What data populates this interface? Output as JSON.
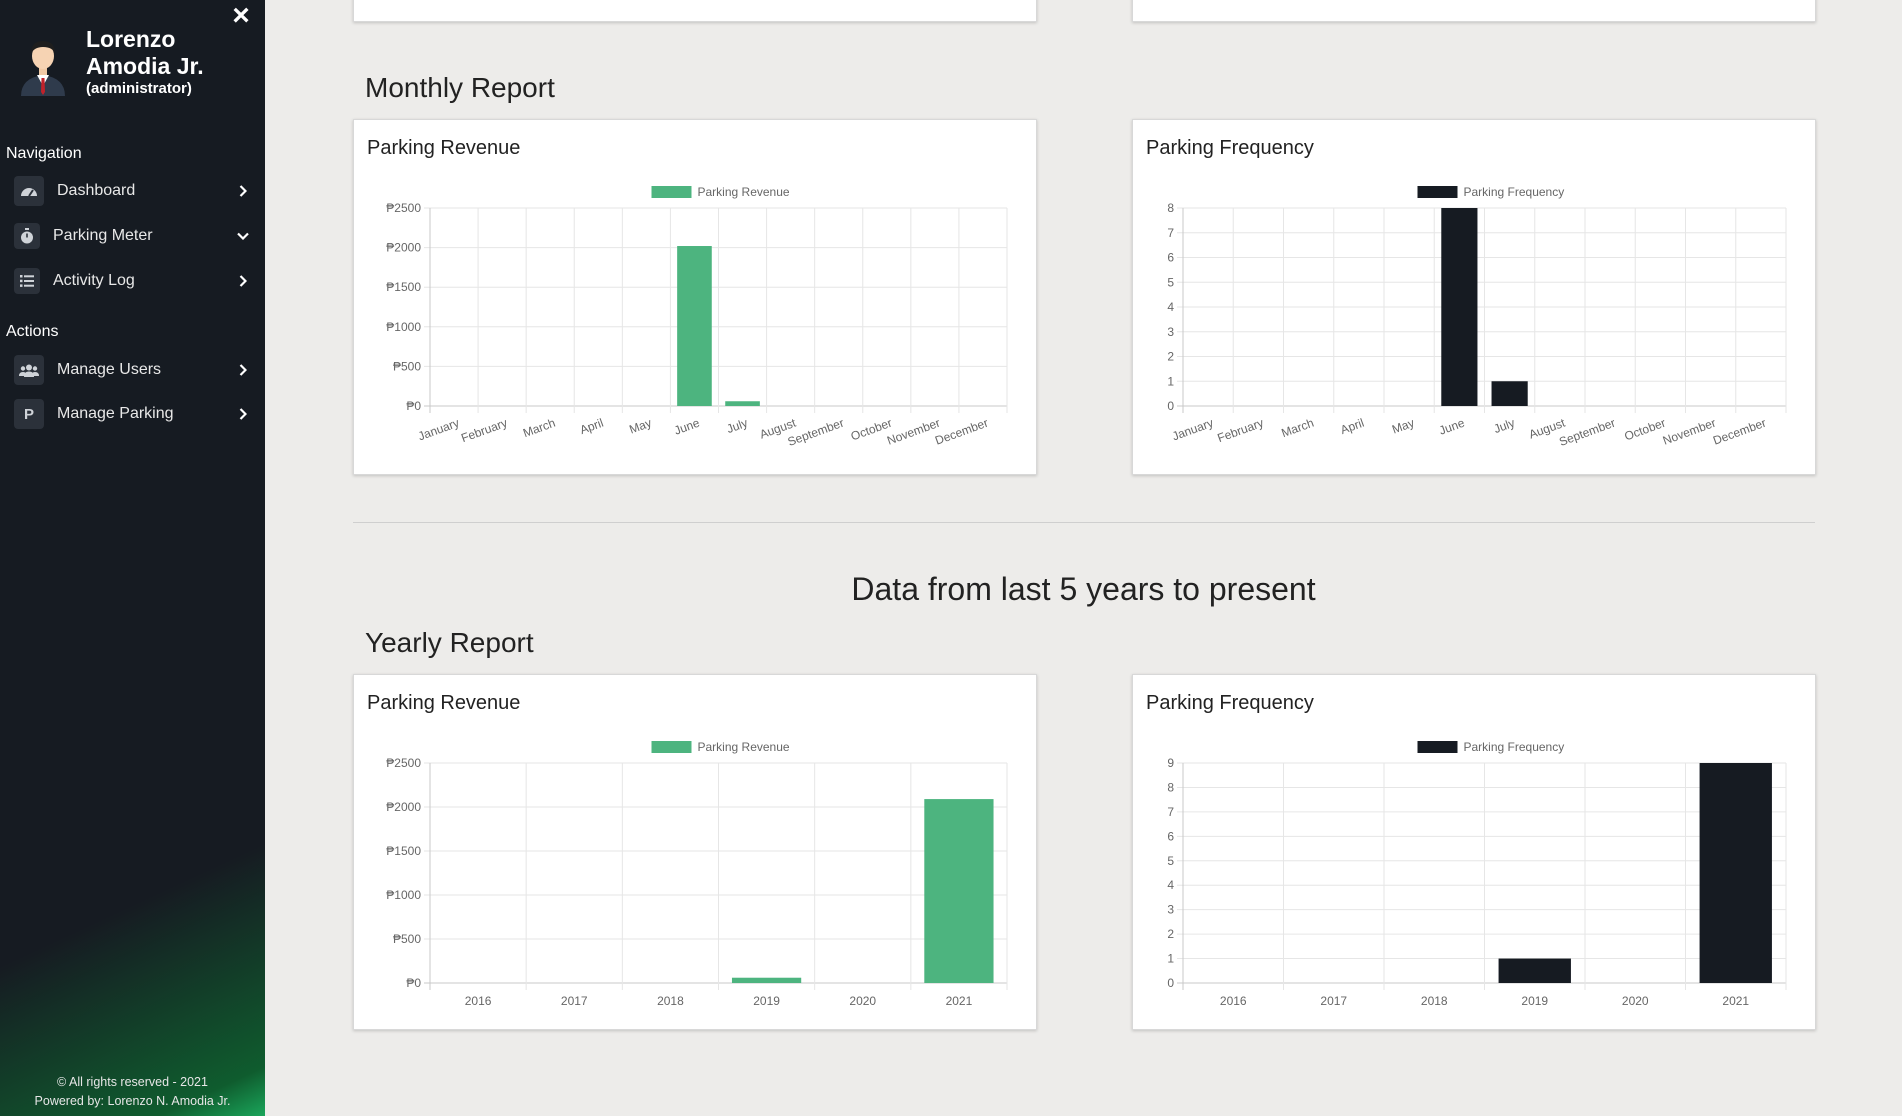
{
  "sidebar": {
    "user_name": "Lorenzo Amodia Jr.",
    "user_role": "(administrator)",
    "navigation_label": "Navigation",
    "actions_label": "Actions",
    "nav_items": [
      {
        "label": "Dashboard",
        "icon": "speedometer-icon",
        "chevron": "chevron-right-icon"
      },
      {
        "label": "Parking Meter",
        "icon": "stopwatch-icon",
        "chevron": "chevron-down-icon"
      },
      {
        "label": "Activity Log",
        "icon": "list-icon",
        "chevron": "chevron-right-icon"
      }
    ],
    "action_items": [
      {
        "label": "Manage Users",
        "icon": "users-icon",
        "chevron": "chevron-right-icon"
      },
      {
        "label": "Manage Parking",
        "icon_letter": "P",
        "icon": "parking-icon",
        "chevron": "chevron-right-icon"
      }
    ],
    "footer_line1": "© All rights reserved - 2021",
    "footer_line2": "Powered by: Lorenzo N. Amodia Jr."
  },
  "main": {
    "monthly_heading": "Monthly Report",
    "yearly_center_heading": "Data from last 5 years to present",
    "yearly_heading": "Yearly Report"
  },
  "colors": {
    "revenue": "#4db47f",
    "frequency": "#161b22",
    "sidebar_bg": "#161b22",
    "page_bg": "#edecea"
  },
  "chart_data": [
    {
      "id": "monthly-revenue",
      "type": "bar",
      "title": "Parking Revenue",
      "categories": [
        "January",
        "February",
        "March",
        "April",
        "May",
        "June",
        "July",
        "August",
        "September",
        "October",
        "November",
        "December"
      ],
      "series": [
        {
          "name": "Parking Revenue",
          "values": [
            0,
            0,
            0,
            0,
            0,
            2020,
            60,
            0,
            0,
            0,
            0,
            0
          ],
          "color": "#4db47f"
        }
      ],
      "yticks": [
        "₱0",
        "₱500",
        "₱1000",
        "₱1500",
        "₱2000",
        "₱2500"
      ],
      "ylim": [
        0,
        2500
      ],
      "grid": true,
      "legend": "top-center",
      "rotate_labels": true
    },
    {
      "id": "monthly-frequency",
      "type": "bar",
      "title": "Parking Frequency",
      "categories": [
        "January",
        "February",
        "March",
        "April",
        "May",
        "June",
        "July",
        "August",
        "September",
        "October",
        "November",
        "December"
      ],
      "series": [
        {
          "name": "Parking Frequency",
          "values": [
            0,
            0,
            0,
            0,
            0,
            8,
            1,
            0,
            0,
            0,
            0,
            0
          ],
          "color": "#161b22"
        }
      ],
      "yticks": [
        "0",
        "1",
        "2",
        "3",
        "4",
        "5",
        "6",
        "7",
        "8"
      ],
      "ylim": [
        0,
        8
      ],
      "grid": true,
      "legend": "top-center",
      "rotate_labels": true
    },
    {
      "id": "yearly-revenue",
      "type": "bar",
      "title": "Parking Revenue",
      "categories": [
        "2016",
        "2017",
        "2018",
        "2019",
        "2020",
        "2021"
      ],
      "series": [
        {
          "name": "Parking Revenue",
          "values": [
            0,
            0,
            0,
            60,
            0,
            2090
          ],
          "color": "#4db47f"
        }
      ],
      "yticks": [
        "₱0",
        "₱500",
        "₱1000",
        "₱1500",
        "₱2000",
        "₱2500"
      ],
      "ylim": [
        0,
        2500
      ],
      "grid": true,
      "legend": "top-center",
      "rotate_labels": false
    },
    {
      "id": "yearly-frequency",
      "type": "bar",
      "title": "Parking Frequency",
      "categories": [
        "2016",
        "2017",
        "2018",
        "2019",
        "2020",
        "2021"
      ],
      "series": [
        {
          "name": "Parking Frequency",
          "values": [
            0,
            0,
            0,
            1,
            0,
            9
          ],
          "color": "#161b22"
        }
      ],
      "yticks": [
        "0",
        "1",
        "2",
        "3",
        "4",
        "5",
        "6",
        "7",
        "8",
        "9"
      ],
      "ylim": [
        0,
        9
      ],
      "grid": true,
      "legend": "top-center",
      "rotate_labels": false
    }
  ]
}
